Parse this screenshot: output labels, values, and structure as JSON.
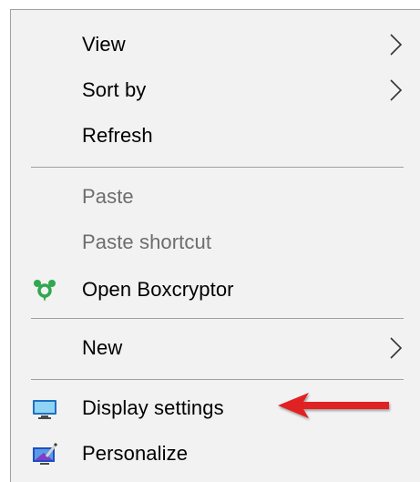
{
  "menu": {
    "items": [
      {
        "label": "View",
        "has_submenu": true,
        "enabled": true
      },
      {
        "label": "Sort by",
        "has_submenu": true,
        "enabled": true
      },
      {
        "label": "Refresh",
        "has_submenu": false,
        "enabled": true
      },
      {
        "label": "Paste",
        "has_submenu": false,
        "enabled": false
      },
      {
        "label": "Paste shortcut",
        "has_submenu": false,
        "enabled": false
      },
      {
        "label": "Open Boxcryptor",
        "has_submenu": false,
        "enabled": true,
        "icon": "boxcryptor-icon"
      },
      {
        "label": "New",
        "has_submenu": true,
        "enabled": true
      },
      {
        "label": "Display settings",
        "has_submenu": false,
        "enabled": true,
        "icon": "display-icon"
      },
      {
        "label": "Personalize",
        "has_submenu": false,
        "enabled": true,
        "icon": "personalize-icon"
      }
    ]
  },
  "annotation": {
    "arrow_color": "#e02020",
    "points_to": "Display settings"
  },
  "colors": {
    "menu_background": "#f2f2f2",
    "separator": "#a0a0a0",
    "disabled_text": "#6d6d6d"
  }
}
